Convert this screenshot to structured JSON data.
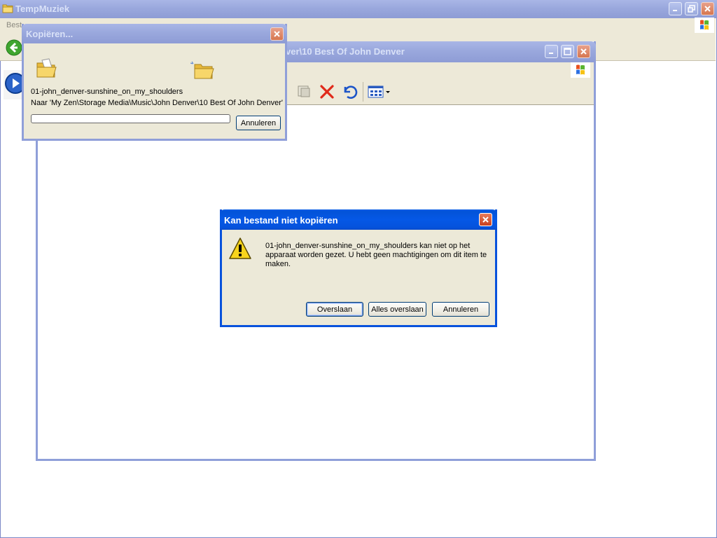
{
  "main_window": {
    "title": "TempMuziek",
    "menu_fragment": "Best"
  },
  "second_window": {
    "title_fragment": "ver\\10 Best Of John Denver"
  },
  "copy_dialog": {
    "title": "Kopiëren...",
    "file_name": "01-john_denver-sunshine_on_my_shoulders",
    "destination": "Naar 'My Zen\\Storage Media\\Music\\John Denver\\10 Best Of John Denver'",
    "progress_fraction": 0.0,
    "cancel_label": "Annuleren"
  },
  "error_dialog": {
    "title": "Kan bestand niet kopiëren",
    "message": "01-john_denver-sunshine_on_my_shoulders kan niet op het apparaat worden gezet. U hebt geen machtigingen om dit item te maken.",
    "buttons": {
      "skip": "Overslaan",
      "skip_all": "Alles overslaan",
      "cancel": "Annuleren"
    },
    "icon": "warning-icon"
  },
  "colors": {
    "active_title": "#0558e6",
    "inactive_title": "#9aa8dd",
    "dialog_face": "#ece9d8"
  }
}
